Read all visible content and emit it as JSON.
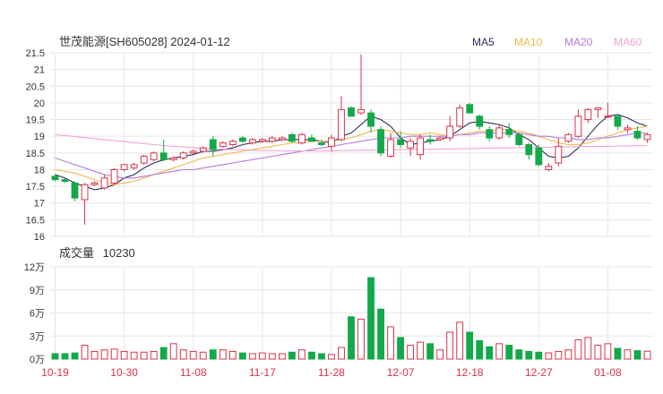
{
  "header": {
    "title": "世茂能源[SH605028] 2024-01-12",
    "legend": [
      {
        "label": "MA5",
        "color": "#2b2f5a"
      },
      {
        "label": "MA10",
        "color": "#f2b84b"
      },
      {
        "label": "MA20",
        "color": "#b67ad9"
      },
      {
        "label": "MA60",
        "color": "#f3a3d6"
      }
    ]
  },
  "volume_header": {
    "label": "成交量",
    "value": "10230"
  },
  "colors": {
    "up": "#d9324a",
    "down": "#13a94a",
    "grid": "#e6e6e6"
  },
  "chart_data": [
    {
      "type": "candlestick",
      "title": "世茂能源[SH605028] 2024-01-12",
      "ylim": [
        16,
        21.5
      ],
      "y_ticks": [
        "21.5",
        "21",
        "20.5",
        "20",
        "19.5",
        "19",
        "18.5",
        "18",
        "17.5",
        "17",
        "16.5",
        "16"
      ],
      "x_ticks": [
        "10-19",
        "10-30",
        "11-08",
        "11-17",
        "11-28",
        "12-07",
        "12-18",
        "12-27",
        "01-08"
      ],
      "x_tick_index": [
        0,
        7,
        14,
        21,
        28,
        35,
        42,
        49,
        56
      ],
      "ohlc": [
        [
          17.8,
          17.85,
          17.65,
          17.7
        ],
        [
          17.7,
          17.75,
          17.6,
          17.65
        ],
        [
          17.6,
          17.65,
          17.05,
          17.15
        ],
        [
          17.1,
          17.6,
          16.35,
          17.55
        ],
        [
          17.55,
          17.65,
          17.5,
          17.6
        ],
        [
          17.45,
          17.85,
          17.4,
          17.75
        ],
        [
          17.6,
          18.05,
          17.55,
          18.0
        ],
        [
          18.0,
          18.15,
          17.95,
          18.15
        ],
        [
          18.05,
          18.2,
          18.0,
          18.15
        ],
        [
          18.2,
          18.45,
          18.15,
          18.4
        ],
        [
          18.3,
          18.55,
          18.25,
          18.5
        ],
        [
          18.5,
          18.9,
          18.25,
          18.3
        ],
        [
          18.3,
          18.4,
          18.25,
          18.35
        ],
        [
          18.35,
          18.55,
          18.3,
          18.5
        ],
        [
          18.5,
          18.6,
          18.45,
          18.55
        ],
        [
          18.55,
          18.7,
          18.5,
          18.65
        ],
        [
          18.9,
          19.0,
          18.4,
          18.6
        ],
        [
          18.7,
          18.85,
          18.65,
          18.8
        ],
        [
          18.75,
          18.9,
          18.7,
          18.85
        ],
        [
          18.95,
          19.0,
          18.8,
          18.85
        ],
        [
          18.8,
          18.95,
          18.75,
          18.9
        ],
        [
          18.85,
          18.95,
          18.8,
          18.9
        ],
        [
          18.85,
          19.0,
          18.8,
          18.95
        ],
        [
          18.9,
          19.0,
          18.85,
          18.95
        ],
        [
          19.05,
          19.1,
          18.8,
          18.85
        ],
        [
          18.8,
          19.1,
          18.75,
          19.05
        ],
        [
          18.95,
          19.05,
          18.85,
          18.85
        ],
        [
          18.8,
          18.9,
          18.7,
          18.75
        ],
        [
          18.7,
          19.05,
          18.55,
          18.95
        ],
        [
          18.9,
          20.2,
          18.85,
          19.8
        ],
        [
          19.85,
          19.9,
          19.6,
          19.6
        ],
        [
          19.7,
          21.45,
          19.65,
          19.8
        ],
        [
          19.7,
          19.8,
          19.1,
          19.3
        ],
        [
          19.2,
          19.3,
          18.4,
          18.5
        ],
        [
          18.4,
          19.1,
          18.35,
          18.9
        ],
        [
          18.9,
          19.15,
          18.65,
          18.75
        ],
        [
          18.65,
          18.95,
          18.4,
          18.85
        ],
        [
          18.45,
          19.05,
          18.3,
          18.95
        ],
        [
          18.9,
          19.05,
          18.75,
          18.85
        ],
        [
          18.9,
          19.0,
          18.85,
          18.95
        ],
        [
          18.95,
          19.6,
          18.85,
          19.3
        ],
        [
          19.3,
          19.95,
          19.25,
          19.85
        ],
        [
          19.95,
          20.0,
          19.7,
          19.7
        ],
        [
          19.6,
          19.65,
          19.2,
          19.3
        ],
        [
          19.2,
          19.3,
          18.85,
          18.95
        ],
        [
          18.95,
          19.35,
          18.9,
          19.25
        ],
        [
          19.2,
          19.4,
          18.95,
          19.05
        ],
        [
          19.05,
          19.1,
          18.7,
          18.75
        ],
        [
          18.75,
          18.8,
          18.3,
          18.45
        ],
        [
          18.65,
          18.75,
          18.1,
          18.15
        ],
        [
          18.0,
          18.2,
          17.95,
          18.1
        ],
        [
          18.2,
          18.95,
          18.1,
          18.7
        ],
        [
          18.85,
          19.1,
          18.8,
          19.05
        ],
        [
          19.0,
          19.8,
          18.95,
          19.6
        ],
        [
          19.5,
          19.85,
          19.4,
          19.8
        ],
        [
          19.8,
          19.85,
          19.55,
          19.85
        ],
        [
          19.6,
          20.0,
          19.55,
          19.6
        ],
        [
          19.6,
          19.6,
          19.2,
          19.3
        ],
        [
          19.2,
          19.35,
          19.1,
          19.25
        ],
        [
          19.15,
          19.3,
          18.9,
          18.95
        ],
        [
          18.9,
          19.1,
          18.8,
          19.05
        ]
      ],
      "ma_series": [
        {
          "name": "MA5",
          "values": [
            17.85,
            17.75,
            17.6,
            17.5,
            17.4,
            17.45,
            17.55,
            17.75,
            17.85,
            18.05,
            18.2,
            18.3,
            18.35,
            18.4,
            18.45,
            18.55,
            18.55,
            18.6,
            18.65,
            18.75,
            18.8,
            18.85,
            18.85,
            18.9,
            18.9,
            18.9,
            18.9,
            18.85,
            18.8,
            19.0,
            19.1,
            19.35,
            19.6,
            19.5,
            19.3,
            18.95,
            18.75,
            18.8,
            18.85,
            18.9,
            19.0,
            19.2,
            19.4,
            19.45,
            19.4,
            19.35,
            19.25,
            19.05,
            18.9,
            18.65,
            18.4,
            18.35,
            18.4,
            18.65,
            19.0,
            19.35,
            19.6,
            19.65,
            19.55,
            19.4,
            19.3
          ]
        },
        {
          "name": "MA10",
          "values": [
            18.0,
            17.95,
            17.9,
            17.8,
            17.7,
            17.6,
            17.55,
            17.6,
            17.65,
            17.75,
            17.85,
            17.95,
            18.05,
            18.15,
            18.25,
            18.35,
            18.4,
            18.45,
            18.5,
            18.55,
            18.6,
            18.65,
            18.7,
            18.75,
            18.8,
            18.8,
            18.85,
            18.85,
            18.85,
            18.9,
            18.95,
            19.05,
            19.15,
            19.2,
            19.15,
            19.1,
            19.05,
            19.05,
            19.1,
            19.05,
            19.0,
            19.05,
            19.1,
            19.15,
            19.15,
            19.2,
            19.2,
            19.15,
            19.1,
            19.0,
            18.9,
            18.8,
            18.75,
            18.75,
            18.8,
            18.9,
            19.0,
            19.1,
            19.2,
            19.25,
            19.3
          ]
        },
        {
          "name": "MA20",
          "values": [
            18.35,
            18.25,
            18.15,
            18.05,
            17.95,
            17.85,
            17.8,
            17.75,
            17.75,
            17.8,
            17.85,
            17.9,
            17.95,
            18.0,
            18.0,
            18.05,
            18.1,
            18.15,
            18.2,
            18.25,
            18.3,
            18.35,
            18.4,
            18.45,
            18.5,
            18.55,
            18.6,
            18.65,
            18.7,
            18.75,
            18.8,
            18.85,
            18.9,
            18.95,
            18.95,
            18.95,
            19.0,
            19.0,
            19.0,
            19.0,
            19.0,
            19.05,
            19.05,
            19.1,
            19.1,
            19.1,
            19.1,
            19.1,
            19.05,
            19.0,
            19.0,
            18.95,
            18.95,
            18.9,
            18.9,
            18.95,
            18.95,
            19.0,
            19.05,
            19.1,
            19.1
          ]
        },
        {
          "name": "MA60",
          "values": [
            19.05,
            19.02,
            18.99,
            18.96,
            18.93,
            18.9,
            18.87,
            18.84,
            18.81,
            18.78,
            18.75,
            18.72,
            18.7,
            18.68,
            18.66,
            18.64,
            18.62,
            18.61,
            18.6,
            18.59,
            18.58,
            18.57,
            18.57,
            18.56,
            18.56,
            18.56,
            18.56,
            18.56,
            18.56,
            18.57,
            18.57,
            18.58,
            18.58,
            18.59,
            18.59,
            18.6,
            18.6,
            18.61,
            18.61,
            18.62,
            18.62,
            18.63,
            18.63,
            18.64,
            18.64,
            18.65,
            18.65,
            18.66,
            18.66,
            18.67,
            18.67,
            18.68,
            18.68,
            18.69,
            18.69,
            18.7,
            18.7,
            18.71,
            18.71,
            18.72,
            18.72
          ]
        }
      ]
    },
    {
      "type": "bar",
      "title": "成交量",
      "ylim": [
        0,
        120000
      ],
      "y_ticks": [
        "12万",
        "9万",
        "6万",
        "3万",
        "0万"
      ],
      "values": [
        7000,
        7000,
        8000,
        18000,
        10000,
        12000,
        13000,
        10000,
        9000,
        9000,
        10000,
        15000,
        20000,
        12000,
        10000,
        9000,
        12000,
        12000,
        10000,
        8000,
        7000,
        8000,
        7000,
        7000,
        9000,
        12000,
        9000,
        7000,
        6000,
        15000,
        55000,
        52000,
        106000,
        65000,
        42000,
        28000,
        18000,
        22000,
        20000,
        12000,
        35000,
        48000,
        35000,
        24000,
        16000,
        20000,
        18000,
        12000,
        10000,
        9000,
        8000,
        10000,
        12000,
        25000,
        28000,
        18000,
        20000,
        14000,
        12000,
        11000,
        10230
      ]
    }
  ]
}
